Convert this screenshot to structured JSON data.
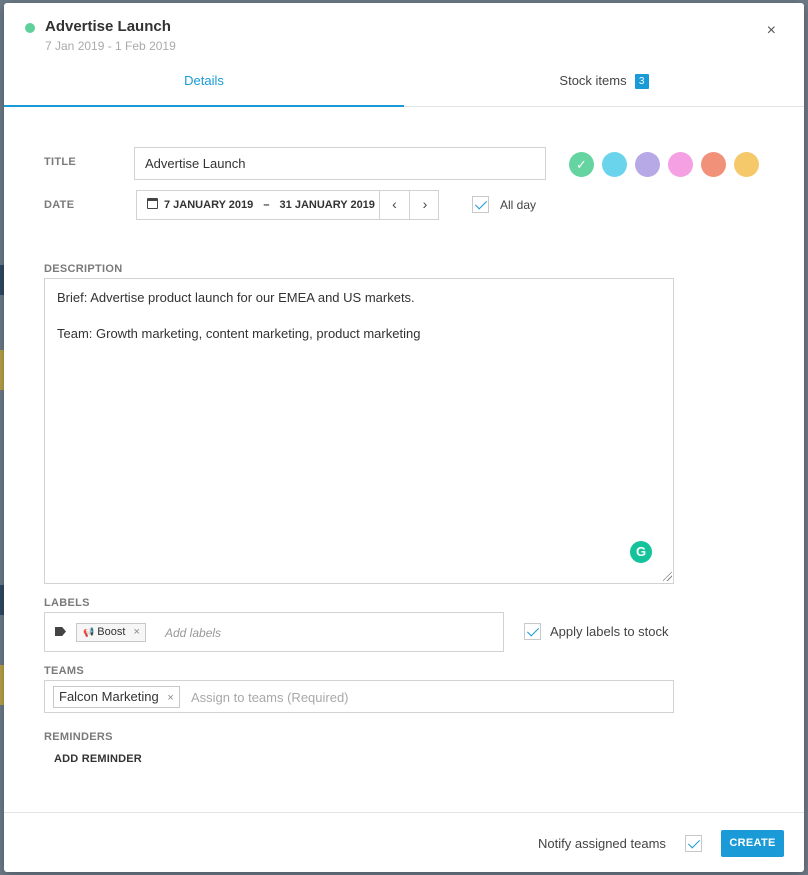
{
  "header": {
    "title": "Advertise Launch",
    "date_range": "7 Jan 2019 - 1 Feb 2019",
    "status_color": "#5fd09a",
    "close_glyph": "×"
  },
  "tabs": [
    {
      "label": "Details",
      "active": true
    },
    {
      "label": "Stock items",
      "badge": "3",
      "active": false
    }
  ],
  "form": {
    "title_label": "TITLE",
    "title_value": "Advertise Launch",
    "colors": [
      {
        "hex": "#66d4a0",
        "selected": true,
        "check": "✓"
      },
      {
        "hex": "#6ad4ec",
        "selected": false
      },
      {
        "hex": "#b7a8e6",
        "selected": false
      },
      {
        "hex": "#f5a0e2",
        "selected": false
      },
      {
        "hex": "#f2917a",
        "selected": false
      },
      {
        "hex": "#f5c969",
        "selected": false
      }
    ],
    "date_label": "DATE",
    "date_start": "7 JANUARY 2019",
    "date_sep": "–",
    "date_end": "31 JANUARY 2019",
    "prev_glyph": "‹",
    "next_glyph": "›",
    "all_day_label": "All day",
    "all_day_checked": true,
    "description_label": "DESCRIPTION",
    "description_lines": [
      "Brief: Advertise product launch for our EMEA and US markets.",
      "Team: Growth marketing, content marketing, product marketing"
    ],
    "grammarly_glyph": "G",
    "labels_label": "LABELS",
    "labels": [
      {
        "icon": "megaphone-icon",
        "icon_glyph": "📢",
        "name": "Boost",
        "remove_glyph": "×"
      }
    ],
    "labels_placeholder": "Add labels",
    "apply_labels_label": "Apply labels to stock",
    "apply_labels_checked": true,
    "teams_label": "TEAMS",
    "teams": [
      {
        "name": "Falcon Marketing",
        "remove_glyph": "×"
      }
    ],
    "teams_placeholder": "Assign to teams (Required)",
    "reminders_label": "REMINDERS",
    "add_reminder_label": "ADD REMINDER"
  },
  "footer": {
    "notify_label": "Notify assigned teams",
    "notify_checked": true,
    "create_label": "CREATE"
  },
  "accent_color": "#1a9bd8"
}
